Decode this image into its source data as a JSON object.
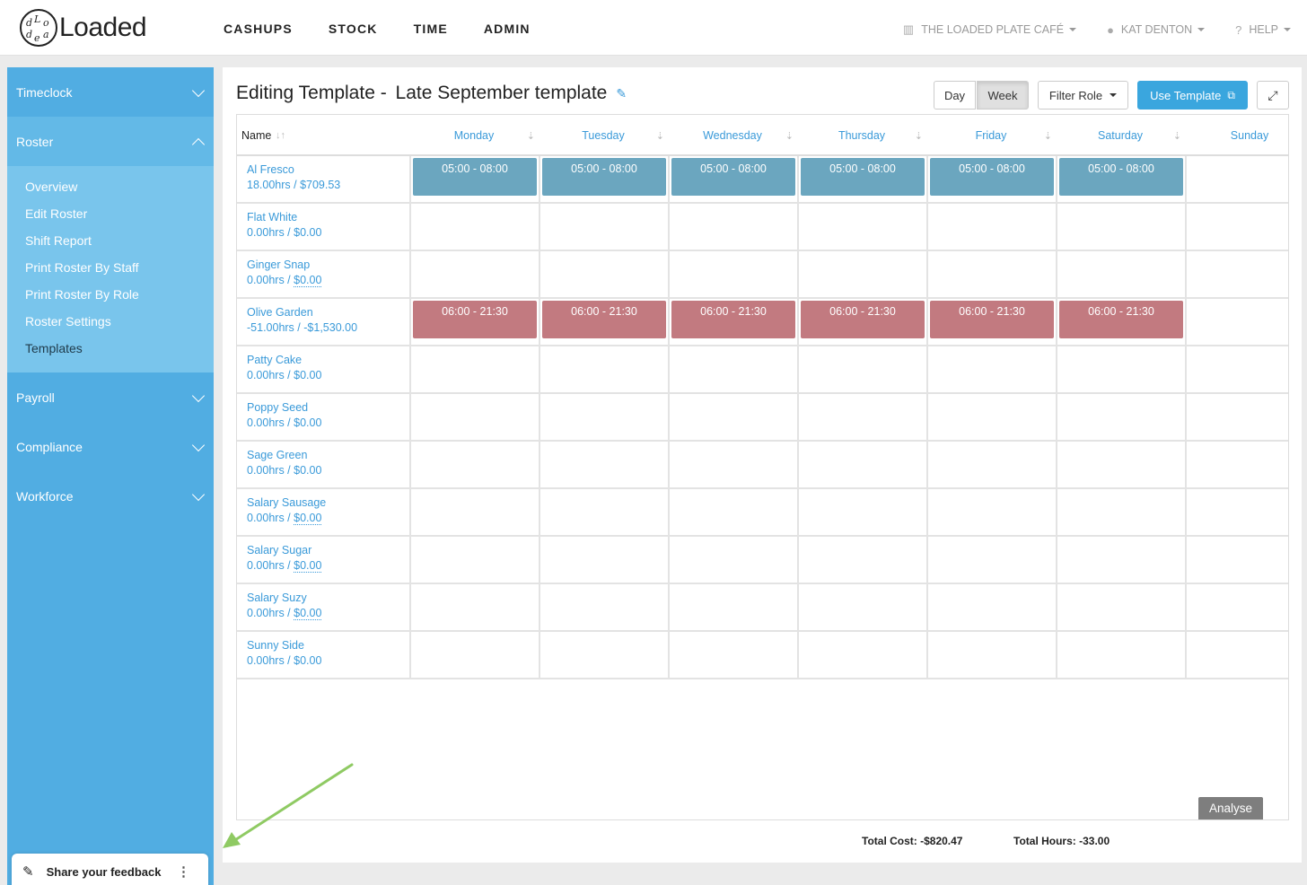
{
  "logo": {
    "mark_letters": [
      "d",
      "L",
      "o",
      "a",
      "e",
      "d"
    ],
    "name": "Loaded"
  },
  "nav": [
    "CASHUPS",
    "STOCK",
    "TIME",
    "ADMIN"
  ],
  "top_right": {
    "venue": "THE LOADED PLATE CAFÉ",
    "user": "KAT DENTON",
    "help": "HELP"
  },
  "sidebar": {
    "timeclock": "Timeclock",
    "roster": "Roster",
    "roster_items": [
      "Overview",
      "Edit Roster",
      "Shift Report",
      "Print Roster By Staff",
      "Print Roster By Role",
      "Roster Settings",
      "Templates"
    ],
    "payroll": "Payroll",
    "compliance": "Compliance",
    "workforce": "Workforce"
  },
  "feedback": {
    "label": "Share your feedback"
  },
  "page": {
    "title_prefix": "Editing Template -",
    "title_name": "Late September template"
  },
  "toolbar": {
    "day": "Day",
    "week": "Week",
    "filter_role": "Filter Role",
    "use_template": "Use Template"
  },
  "table": {
    "name_header": "Name",
    "days": [
      "Monday",
      "Tuesday",
      "Wednesday",
      "Thursday",
      "Friday",
      "Saturday",
      "Sunday"
    ],
    "rows": [
      {
        "name": "Al Fresco",
        "hours": "18.00hrs /",
        "cost": "$709.53",
        "dotted": false,
        "shift": "05:00 - 08:00",
        "shift_days": 6,
        "color": "#6ba6bf"
      },
      {
        "name": "Flat White",
        "hours": "0.00hrs /",
        "cost": "$0.00",
        "dotted": false,
        "shift": "",
        "shift_days": 0,
        "color": ""
      },
      {
        "name": "Ginger Snap",
        "hours": "0.00hrs /",
        "cost": "$0.00",
        "dotted": true,
        "shift": "",
        "shift_days": 0,
        "color": ""
      },
      {
        "name": "Olive Garden",
        "hours": "-51.00hrs /",
        "cost": "-$1,530.00",
        "dotted": false,
        "shift": "06:00 - 21:30",
        "shift_days": 6,
        "color": "#c27a80"
      },
      {
        "name": "Patty Cake",
        "hours": "0.00hrs /",
        "cost": "$0.00",
        "dotted": false,
        "shift": "",
        "shift_days": 0,
        "color": ""
      },
      {
        "name": "Poppy Seed",
        "hours": "0.00hrs /",
        "cost": "$0.00",
        "dotted": false,
        "shift": "",
        "shift_days": 0,
        "color": ""
      },
      {
        "name": "Sage Green",
        "hours": "0.00hrs /",
        "cost": "$0.00",
        "dotted": false,
        "shift": "",
        "shift_days": 0,
        "color": ""
      },
      {
        "name": "Salary Sausage",
        "hours": "0.00hrs /",
        "cost": "$0.00",
        "dotted": true,
        "shift": "",
        "shift_days": 0,
        "color": ""
      },
      {
        "name": "Salary Sugar",
        "hours": "0.00hrs /",
        "cost": "$0.00",
        "dotted": true,
        "shift": "",
        "shift_days": 0,
        "color": ""
      },
      {
        "name": "Salary Suzy",
        "hours": "0.00hrs /",
        "cost": "$0.00",
        "dotted": true,
        "shift": "",
        "shift_days": 0,
        "color": ""
      },
      {
        "name": "Sunny Side",
        "hours": "0.00hrs /",
        "cost": "$0.00",
        "dotted": false,
        "shift": "",
        "shift_days": 0,
        "color": ""
      }
    ]
  },
  "analyse": "Analyse",
  "totals": {
    "cost": "Total Cost: -$820.47",
    "hours": "Total Hours: -33.00"
  },
  "colors": {
    "accent": "#51ade2",
    "link": "#3a9ad9",
    "annotation_arrow": "#8fca63"
  }
}
